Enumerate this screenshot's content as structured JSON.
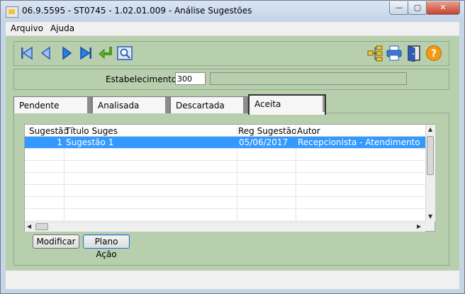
{
  "window": {
    "title": "06.9.5595 - ST0745 - 1.02.01.009 - Análise Sugestões",
    "min_glyph": "—",
    "max_glyph": "▢",
    "close_glyph": "✕"
  },
  "menu": [
    "Arquivo",
    "Ajuda"
  ],
  "toolbar": {
    "icons": [
      "first-icon",
      "previous-icon",
      "next-icon",
      "last-icon",
      "enter-icon",
      "preview-icon",
      "tree-icon",
      "print-icon",
      "exit-door-icon",
      "help-icon"
    ],
    "help_glyph": "?"
  },
  "estabelecimento": {
    "label": "Estabelecimento:",
    "code": "300",
    "name": ""
  },
  "tabs": [
    "Pendente",
    "Analisada",
    "Descartada",
    "Aceita"
  ],
  "active_tab": "Aceita",
  "grid": {
    "columns": [
      "Sugestão",
      "Título Suges",
      "Reg Sugestão",
      "Autor"
    ],
    "rows": [
      [
        "1",
        "Sugestão 1",
        "05/06/2017",
        "Recepcionista - Atendimento"
      ]
    ],
    "selected_row": 0
  },
  "buttons": {
    "modificar": "Modificar",
    "plano_acao": "Plano Ação"
  },
  "colors": {
    "panel_bg": "#b8cfae",
    "selection": "#3399ff"
  }
}
